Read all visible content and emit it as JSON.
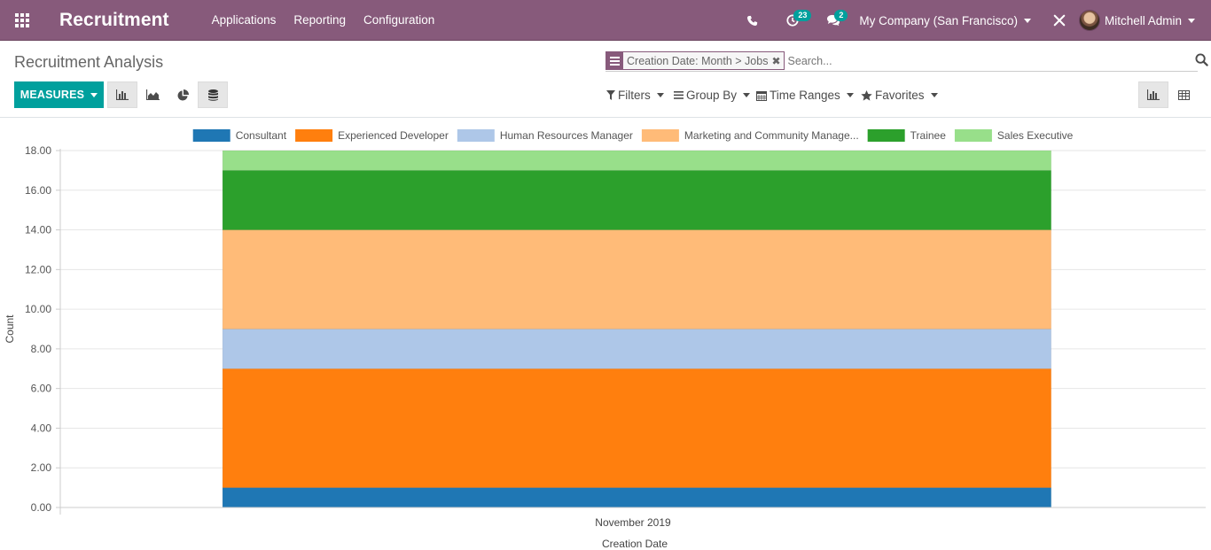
{
  "navbar": {
    "app_title": "Recruitment",
    "menu": [
      "Applications",
      "Reporting",
      "Configuration"
    ],
    "activity_count": "23",
    "message_count": "2",
    "company": "My Company (San Francisco)",
    "user": "Mitchell Admin",
    "bg_color": "#875A7B"
  },
  "control_panel": {
    "breadcrumb": "Recruitment Analysis",
    "search": {
      "facet": "Creation Date: Month > Jobs",
      "placeholder": "Search..."
    },
    "measures_label": "MEASURES",
    "filters": {
      "filters_label": "Filters",
      "group_by_label": "Group By",
      "time_ranges_label": "Time Ranges",
      "favorites_label": "Favorites"
    },
    "accent_color": "#00A09D"
  },
  "chart_data": {
    "type": "bar",
    "stacked": true,
    "categories": [
      "November 2019"
    ],
    "series": [
      {
        "name": "Consultant",
        "values": [
          1
        ],
        "color": "#1f77b4"
      },
      {
        "name": "Experienced Developer",
        "values": [
          6
        ],
        "color": "#ff7f0e"
      },
      {
        "name": "Human Resources Manager",
        "values": [
          2
        ],
        "color": "#aec7e8"
      },
      {
        "name": "Marketing and Community Manage...",
        "values": [
          5
        ],
        "color": "#ffbb78"
      },
      {
        "name": "Trainee",
        "values": [
          3
        ],
        "color": "#2ca02c"
      },
      {
        "name": "Sales Executive",
        "values": [
          1
        ],
        "color": "#98df8a"
      }
    ],
    "xlabel": "Creation Date",
    "ylabel": "Count",
    "ylim": [
      0,
      18
    ],
    "yticks": [
      "0.00",
      "2.00",
      "4.00",
      "6.00",
      "8.00",
      "10.00",
      "12.00",
      "14.00",
      "16.00",
      "18.00"
    ],
    "grid": true,
    "legend_position": "top"
  }
}
